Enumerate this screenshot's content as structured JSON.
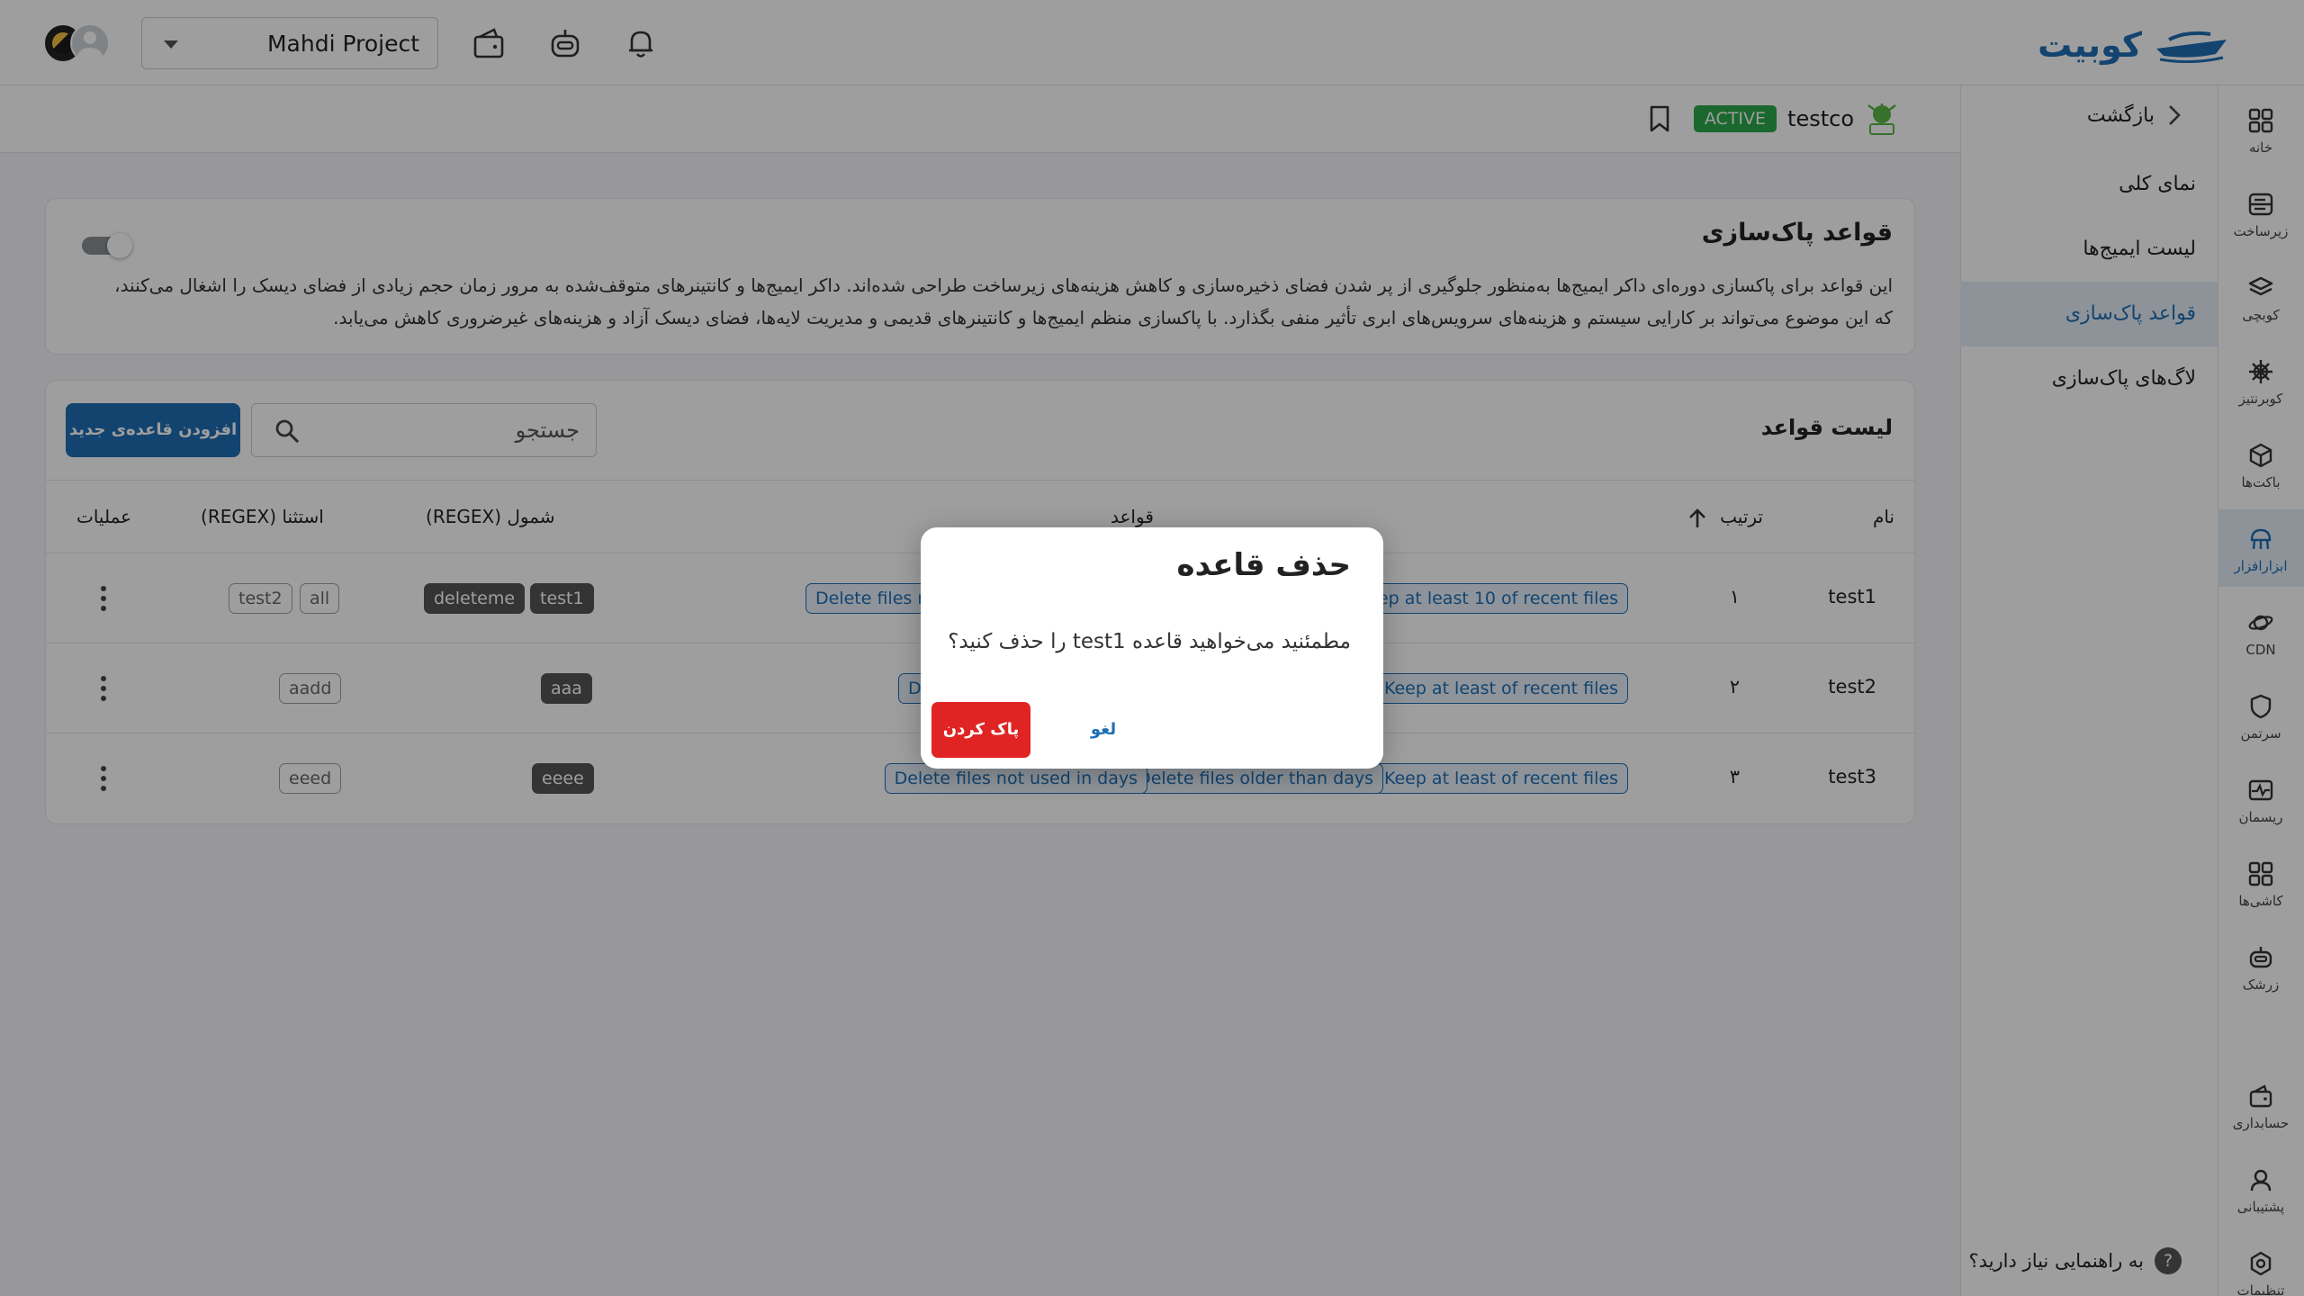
{
  "app": {
    "logo_text": "کوبیت"
  },
  "topbar": {
    "project": "Mahdi Project"
  },
  "rail": [
    {
      "label": "خانه",
      "icon": "grid-icon"
    },
    {
      "label": "زیرساخت",
      "icon": "server-icon"
    },
    {
      "label": "کوبچی",
      "icon": "layers-icon"
    },
    {
      "label": "کوبرنتیز",
      "icon": "helm-icon"
    },
    {
      "label": "باکت‌ها",
      "icon": "box-icon"
    },
    {
      "label": "ابزارافزار",
      "icon": "tools-icon"
    },
    {
      "label": "CDN",
      "icon": "planet-icon"
    },
    {
      "label": "سرتمن",
      "icon": "shield-icon"
    },
    {
      "label": "ریسمان",
      "icon": "pulse-icon"
    },
    {
      "label": "کاشی‌ها",
      "icon": "tiles-icon"
    },
    {
      "label": "زرشک",
      "icon": "bot-icon"
    },
    {
      "label": "حسابداری",
      "icon": "wallet-icon"
    },
    {
      "label": "پشتیبانی",
      "icon": "support-icon"
    },
    {
      "label": "تنظیمات",
      "icon": "gear-icon"
    }
  ],
  "subnav": {
    "back": "بازگشت",
    "items": [
      "نمای کلی",
      "لیست ایمیج‌ها",
      "قواعد پاک‌سازی",
      "لاگ‌های پاک‌سازی"
    ],
    "help": "به راهنمایی نیاز دارید؟",
    "help_mark": "?"
  },
  "header": {
    "name": "testco",
    "status": "ACTIVE"
  },
  "info": {
    "title": "قواعد پاک‌سازی",
    "description": "این قواعد برای پاکسازی دوره‌ای داکر ایمیج‌ها به‌منظور جلوگیری از پر شدن فضای ذخیره‌سازی و کاهش هزینه‌های زیرساخت طراحی شده‌اند. داکر ایمیج‌ها و کانتینرهای متوقف‌شده به مرور زمان حجم زیادی از فضای دیسک را اشغال می‌کنند، که این موضوع می‌تواند بر کارایی سیستم و هزینه‌های سرویس‌های ابری تأثیر منفی بگذارد. با پاکسازی منظم ایمیج‌ها و کانتینرهای قدیمی و مدیریت لایه‌ها، فضای دیسک آزاد و هزینه‌های غیرضروری کاهش می‌یابد."
  },
  "rules": {
    "title": "لیست قواعد",
    "add_button": "افزودن قاعده‌ی جدید",
    "search_placeholder": "جستجو",
    "columns": {
      "name": "نام",
      "order": "ترتیب",
      "rules": "قواعد",
      "include": "شمول (REGEX)",
      "exclude": "استثنا (REGEX)",
      "actions": "عملیات"
    },
    "rows": [
      {
        "name": "test1",
        "order": "۱",
        "rules": [
          "Keep at least 10 of recent files",
          "Delete files n"
        ],
        "include": [
          "test1",
          "deleteme"
        ],
        "exclude": [
          "all",
          "test2"
        ]
      },
      {
        "name": "test2",
        "order": "۲",
        "rules": [
          "Keep at least of recent files",
          "D"
        ],
        "include": [
          "aaa"
        ],
        "exclude": [
          "aadd"
        ]
      },
      {
        "name": "test3",
        "order": "۳",
        "rules": [
          "Keep at least of recent files",
          "Delete files older than days",
          "Delete files not used in days"
        ],
        "include": [
          "eeee"
        ],
        "exclude": [
          "eeed"
        ]
      }
    ]
  },
  "dialog": {
    "title": "حذف قاعده",
    "message": "مطمئنید می‌خواهید قاعده test1 را حذف کنید؟",
    "confirm": "پاک کردن",
    "cancel": "لغو"
  },
  "colors": {
    "primary": "#1f6fb5",
    "danger": "#e02424",
    "success": "#2aa84a"
  }
}
